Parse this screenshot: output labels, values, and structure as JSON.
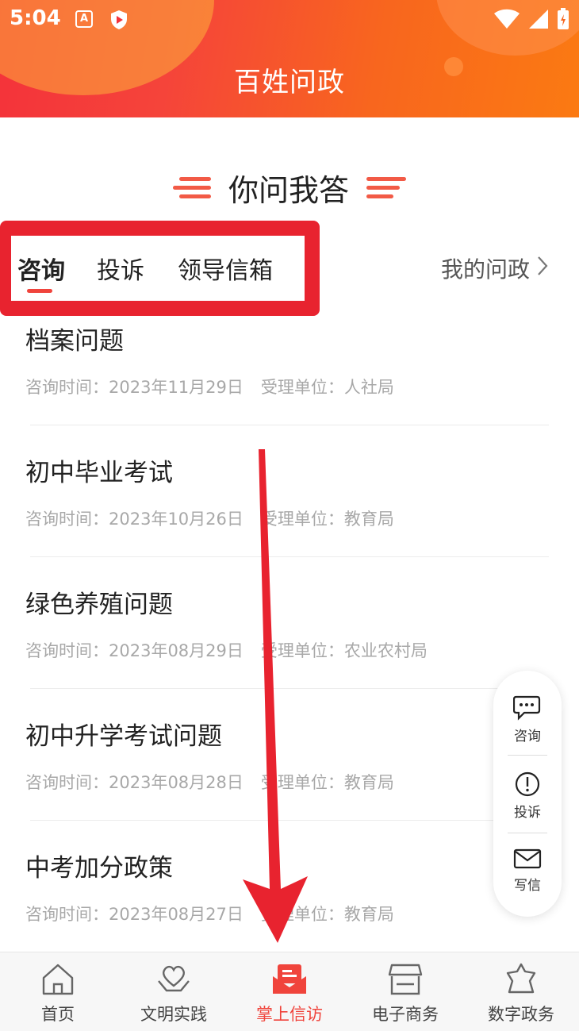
{
  "status_bar": {
    "time": "5:04",
    "app_icon_a": "A"
  },
  "header": {
    "title": "百姓问政"
  },
  "section": {
    "title": "你问我答"
  },
  "tabs": [
    {
      "label": "咨询",
      "active": true
    },
    {
      "label": "投诉",
      "active": false
    },
    {
      "label": "领导信箱",
      "active": false
    }
  ],
  "my_politics": {
    "label": "我的问政"
  },
  "list": [
    {
      "title": "档案问题",
      "time": "咨询时间：2023年11月29日",
      "unit": "受理单位：人社局"
    },
    {
      "title": "初中毕业考试",
      "time": "咨询时间：2023年10月26日",
      "unit": "受理单位：教育局"
    },
    {
      "title": "绿色养殖问题",
      "time": "咨询时间：2023年08月29日",
      "unit": "受理单位：农业农村局"
    },
    {
      "title": "初中升学考试问题",
      "time": "咨询时间：2023年08月28日",
      "unit": "受理单位：教育局"
    },
    {
      "title": "中考加分政策",
      "time": "咨询时间：2023年08月27日",
      "unit": "受理单位：教育局"
    }
  ],
  "float_menu": [
    {
      "label": "咨询",
      "icon": "chat-bubble-icon"
    },
    {
      "label": "投诉",
      "icon": "alert-circle-icon"
    },
    {
      "label": "写信",
      "icon": "envelope-icon"
    }
  ],
  "bottom_nav": [
    {
      "label": "首页",
      "icon": "home-icon",
      "active": false
    },
    {
      "label": "文明实践",
      "icon": "heart-hands-icon",
      "active": false
    },
    {
      "label": "掌上信访",
      "icon": "mail-tray-icon",
      "active": true
    },
    {
      "label": "电子商务",
      "icon": "store-icon",
      "active": false
    },
    {
      "label": "数字政务",
      "icon": "government-icon",
      "active": false
    }
  ],
  "colors": {
    "accent": "#f0443c",
    "highlight_box": "#e8232f",
    "header_start": "#f4323a",
    "header_end": "#fb7a12"
  }
}
